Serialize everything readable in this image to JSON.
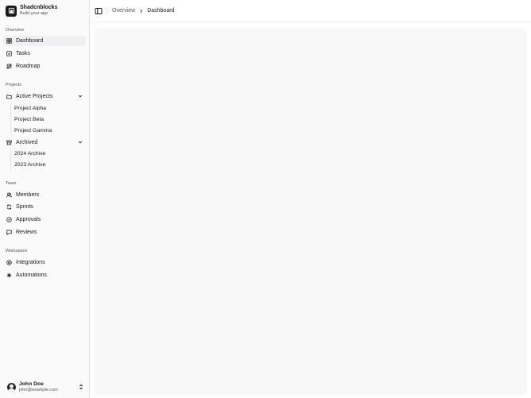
{
  "brand": {
    "name": "Shadcnblocks",
    "tagline": "Build your app"
  },
  "sidebar": {
    "overview": {
      "label": "Overview",
      "items": [
        {
          "label": "Dashboard",
          "icon": "layout-grid-icon",
          "active": true
        },
        {
          "label": "Tasks",
          "icon": "list-checks-icon"
        },
        {
          "label": "Roadmap",
          "icon": "route-icon"
        }
      ]
    },
    "projects": {
      "label": "Projects",
      "active_group": {
        "label": "Active Projects",
        "items": [
          "Project Alpha",
          "Project Beta",
          "Project Gamma"
        ]
      },
      "archived_group": {
        "label": "Archived",
        "items": [
          "2024 Archive",
          "2023 Archive"
        ]
      }
    },
    "team": {
      "label": "Team",
      "items": [
        {
          "label": "Members",
          "icon": "users-icon"
        },
        {
          "label": "Sprints",
          "icon": "refresh-icon"
        },
        {
          "label": "Approvals",
          "icon": "check-circle-icon"
        },
        {
          "label": "Reviews",
          "icon": "message-icon"
        }
      ]
    },
    "workspace": {
      "label": "Workspace",
      "items": [
        {
          "label": "Integrations",
          "icon": "link-circle-icon"
        },
        {
          "label": "Automations",
          "icon": "sparkles-icon"
        }
      ]
    },
    "user": {
      "name": "John Doe",
      "email": "john@example.com"
    }
  },
  "header": {
    "breadcrumb": {
      "parent": "Overview",
      "current": "Dashboard"
    }
  },
  "colors": {
    "accent_bg": "#f0f0f2",
    "text": "#18181b",
    "muted": "#52525b"
  }
}
